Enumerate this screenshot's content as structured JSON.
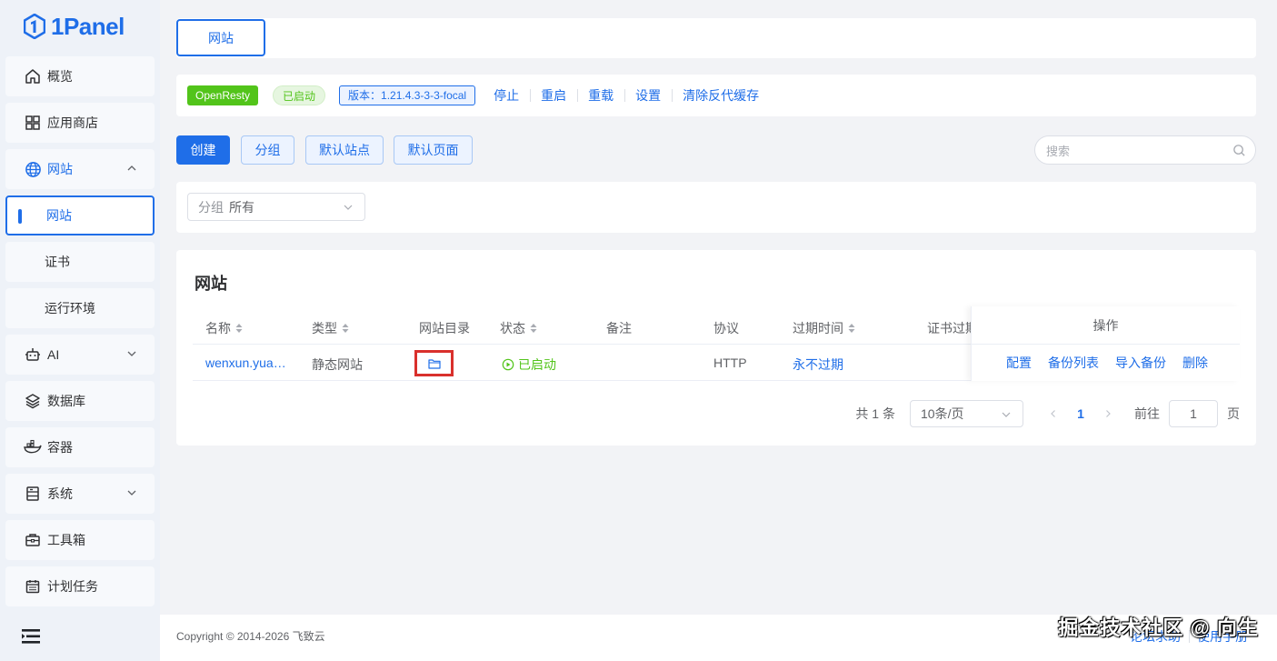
{
  "brand": {
    "name": "1Panel"
  },
  "sidebar": {
    "items": [
      {
        "label": "概览",
        "icon": "home-icon"
      },
      {
        "label": "应用商店",
        "icon": "grid-icon"
      },
      {
        "label": "网站",
        "icon": "globe-icon",
        "expanded": true,
        "children": [
          {
            "label": "网站",
            "active": true
          },
          {
            "label": "证书"
          },
          {
            "label": "运行环境"
          }
        ]
      },
      {
        "label": "AI",
        "icon": "robot-icon"
      },
      {
        "label": "数据库",
        "icon": "layers-icon"
      },
      {
        "label": "容器",
        "icon": "docker-icon"
      },
      {
        "label": "系统",
        "icon": "server-icon"
      },
      {
        "label": "工具箱",
        "icon": "toolbox-icon"
      },
      {
        "label": "计划任务",
        "icon": "calendar-icon"
      }
    ]
  },
  "tabs": [
    {
      "label": "网站",
      "active": true
    }
  ],
  "appbar": {
    "app_name": "OpenResty",
    "status": "已启动",
    "version": "版本：1.21.4.3-3-3-focal",
    "actions": [
      "停止",
      "重启",
      "重载",
      "设置",
      "清除反代缓存"
    ]
  },
  "toolbar": {
    "create": "创建",
    "group": "分组",
    "default_site": "默认站点",
    "default_page": "默认页面",
    "search_placeholder": "搜索"
  },
  "filter": {
    "prefix": "分组",
    "value": "所有"
  },
  "table": {
    "title": "网站",
    "columns": [
      "名称",
      "类型",
      "网站目录",
      "状态",
      "备注",
      "协议",
      "过期时间",
      "证书过期",
      "操作"
    ],
    "rows": [
      {
        "name": "wenxun.yua…",
        "type": "静态网站",
        "status": "已启动",
        "remark": "",
        "protocol": "HTTP",
        "expire": "永不过期",
        "cert_expire": "",
        "ops": [
          "配置",
          "备份列表",
          "导入备份",
          "删除"
        ]
      }
    ]
  },
  "pagination": {
    "total": "共 1 条",
    "page_size": "10条/页",
    "current": "1",
    "goto_label": "前往",
    "goto_value": "1",
    "page_suffix": "页"
  },
  "footer": {
    "copyright": "Copyright © 2014-2026 飞致云",
    "links": [
      "论坛求助",
      "使用手册"
    ]
  },
  "watermark": "掘金技术社区 @ 向生",
  "colors": {
    "primary": "#1f6ee8",
    "success": "#52c41a",
    "highlight": "#d9302c"
  }
}
